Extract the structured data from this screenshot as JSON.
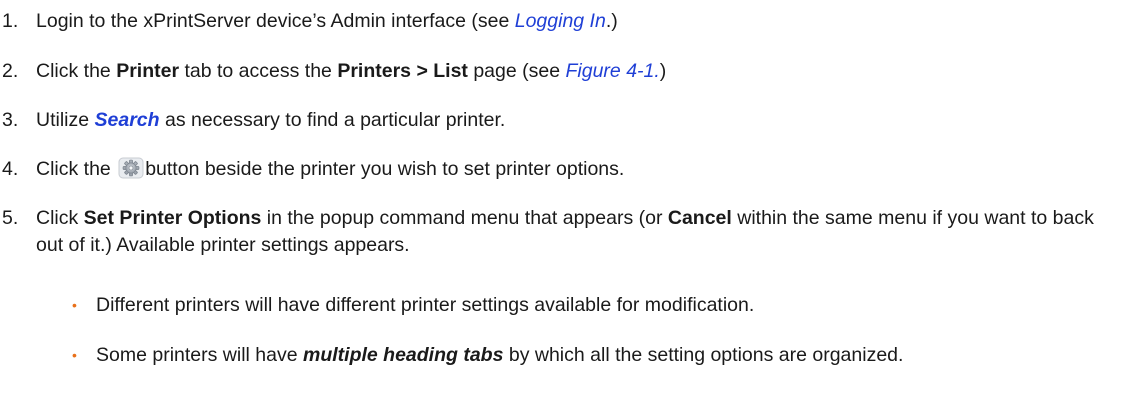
{
  "steps": [
    {
      "number": "1.",
      "p1": "Login to the xPrintServer device’s Admin interface (see ",
      "link": "Logging In",
      "p2": ".)"
    },
    {
      "number": "2.",
      "p1": "Click the ",
      "b1": "Printer",
      "p2": " tab to access the ",
      "b2": "Printers > List",
      "p3": " page (see ",
      "link": "Figure 4-1.",
      "p4": ")"
    },
    {
      "number": "3.",
      "p1": "Utilize ",
      "link": "Search",
      "p2": " as necessary to find a particular printer."
    },
    {
      "number": "4.",
      "p1": "Click the ",
      "icon": "gear-icon",
      "p2": "button beside the printer you wish to set printer options."
    },
    {
      "number": "5.",
      "p1": "Click ",
      "b1": "Set Printer Options",
      "p2": " in the popup command menu that appears (or ",
      "b2": "Cancel",
      "p3": " within the same menu if you want to back out of it.) Available printer settings appears."
    }
  ],
  "bullets": [
    {
      "p1": "Different printers will have different printer settings available for modification."
    },
    {
      "p1": "Some printers will have ",
      "bi": "multiple heading tabs",
      "p2": " by which all the setting options are organized."
    }
  ],
  "bullet_glyph": "•",
  "colors": {
    "link": "#1f3fd6",
    "bullet": "#e8701a",
    "text": "#1a1a1a"
  }
}
